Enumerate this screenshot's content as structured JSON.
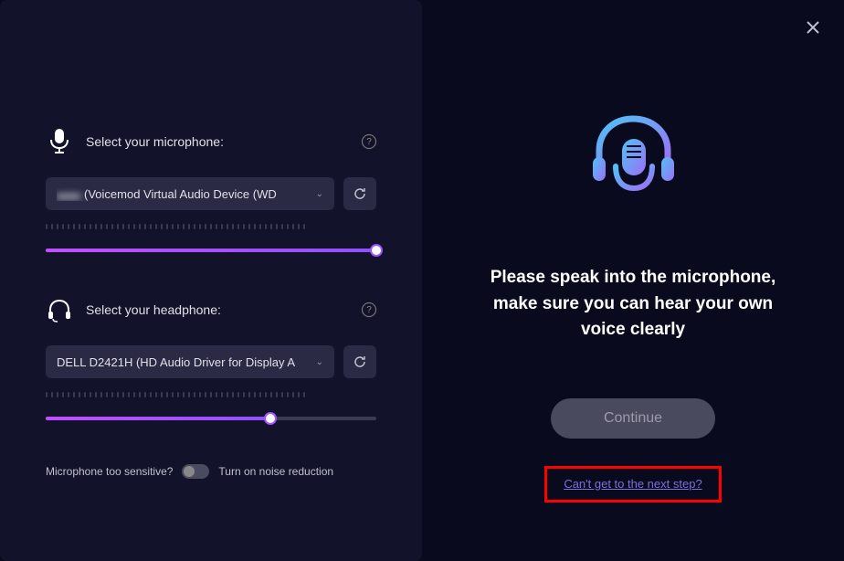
{
  "left": {
    "mic": {
      "label": "Select your microphone:",
      "device_prefix": "▬▬",
      "device": "(Voicemod Virtual Audio Device (WD",
      "slider_percent": 100
    },
    "headphone": {
      "label": "Select your headphone:",
      "device": "DELL D2421H (HD Audio Driver for Display A",
      "slider_percent": 68
    },
    "noise": {
      "question": "Microphone too sensitive?",
      "action": "Turn on noise reduction"
    }
  },
  "right": {
    "instruction": "Please speak into the microphone, make sure you can hear your own voice clearly",
    "continue": "Continue",
    "help_link": "Can't get to the next step?"
  }
}
